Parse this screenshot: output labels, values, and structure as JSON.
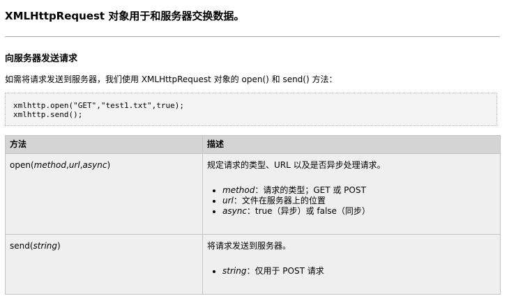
{
  "title": "XMLHttpRequest 对象用于和服务器交换数据。",
  "section": "向服务器发送请求",
  "intro": {
    "before": "如需将请求发送到服务器，我们使用 XMLHttpRequest 对象的 open() 和 send() 方法：",
    "after": ""
  },
  "code": {
    "line1": "xmlhttp.open(\"GET\",\"test1.txt\",true);",
    "line2": "xmlhttp.send();"
  },
  "table": {
    "headers": [
      "方法",
      "描述"
    ],
    "rows": [
      {
        "method_name": "open(",
        "method_args": [
          "method",
          "url",
          "async"
        ],
        "method_close": ")",
        "description": "规定请求的类型、URL 以及是否异步处理请求。",
        "bullets": [
          {
            "term": "method",
            "text": "：请求的类型；GET 或 POST"
          },
          {
            "term": "url",
            "text": "：文件在服务器上的位置"
          },
          {
            "term": "async",
            "text": "：true（异步）或 false（同步）"
          }
        ]
      },
      {
        "method_name": "send(",
        "method_args": [
          "string"
        ],
        "method_close": ")",
        "description": "将请求发送到服务器。",
        "bullets": [
          {
            "term": "string",
            "text": "：仅用于 POST 请求"
          }
        ]
      }
    ]
  }
}
